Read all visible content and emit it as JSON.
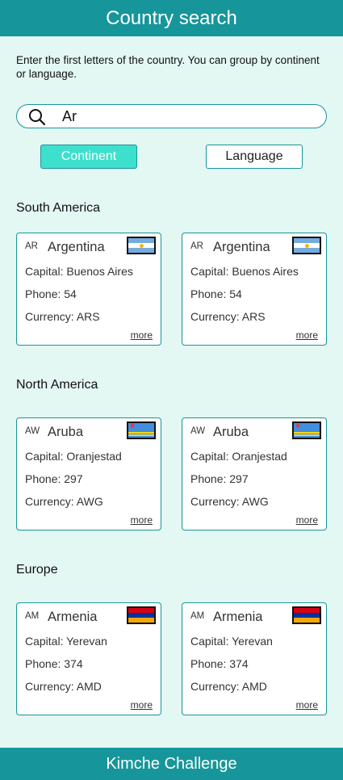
{
  "app": {
    "title": "Country search",
    "footer": "Kimche Challenge",
    "instructions": "Enter the first letters of the country. You can group by continent or language."
  },
  "search": {
    "value": "Ar",
    "icon": "search-icon"
  },
  "grouping": {
    "continent_label": "Continent",
    "language_label": "Language",
    "active": "Continent"
  },
  "groups": [
    {
      "title": "South America",
      "cards": [
        {
          "code": "AR",
          "name": "Argentina",
          "capital": "Capital: Buenos Aires",
          "phone": "Phone: 54",
          "currency": "Currency: ARS",
          "more": "more",
          "flag": "argentina-flag-icon"
        },
        {
          "code": "AR",
          "name": "Argentina",
          "capital": "Capital: Buenos Aires",
          "phone": "Phone: 54",
          "currency": "Currency: ARS",
          "more": "more",
          "flag": "argentina-flag-icon"
        }
      ]
    },
    {
      "title": "North America",
      "cards": [
        {
          "code": "AW",
          "name": "Aruba",
          "capital": "Capital: Oranjestad",
          "phone": "Phone: 297",
          "currency": "Currency: AWG",
          "more": "more",
          "flag": "aruba-flag-icon"
        },
        {
          "code": "AW",
          "name": "Aruba",
          "capital": "Capital: Oranjestad",
          "phone": "Phone: 297",
          "currency": "Currency: AWG",
          "more": "more",
          "flag": "aruba-flag-icon"
        }
      ]
    },
    {
      "title": "Europe",
      "cards": [
        {
          "code": "AM",
          "name": "Armenia",
          "capital": "Capital: Yerevan",
          "phone": "Phone: 374",
          "currency": "Currency: AMD",
          "more": "more",
          "flag": "armenia-flag-icon"
        },
        {
          "code": "AM",
          "name": "Armenia",
          "capital": "Capital: Yerevan",
          "phone": "Phone: 374",
          "currency": "Currency: AMD",
          "more": "more",
          "flag": "armenia-flag-icon"
        }
      ]
    }
  ],
  "colors": {
    "primary": "#16969a",
    "accent": "#3de0cd",
    "background": "#e3f7f3"
  }
}
